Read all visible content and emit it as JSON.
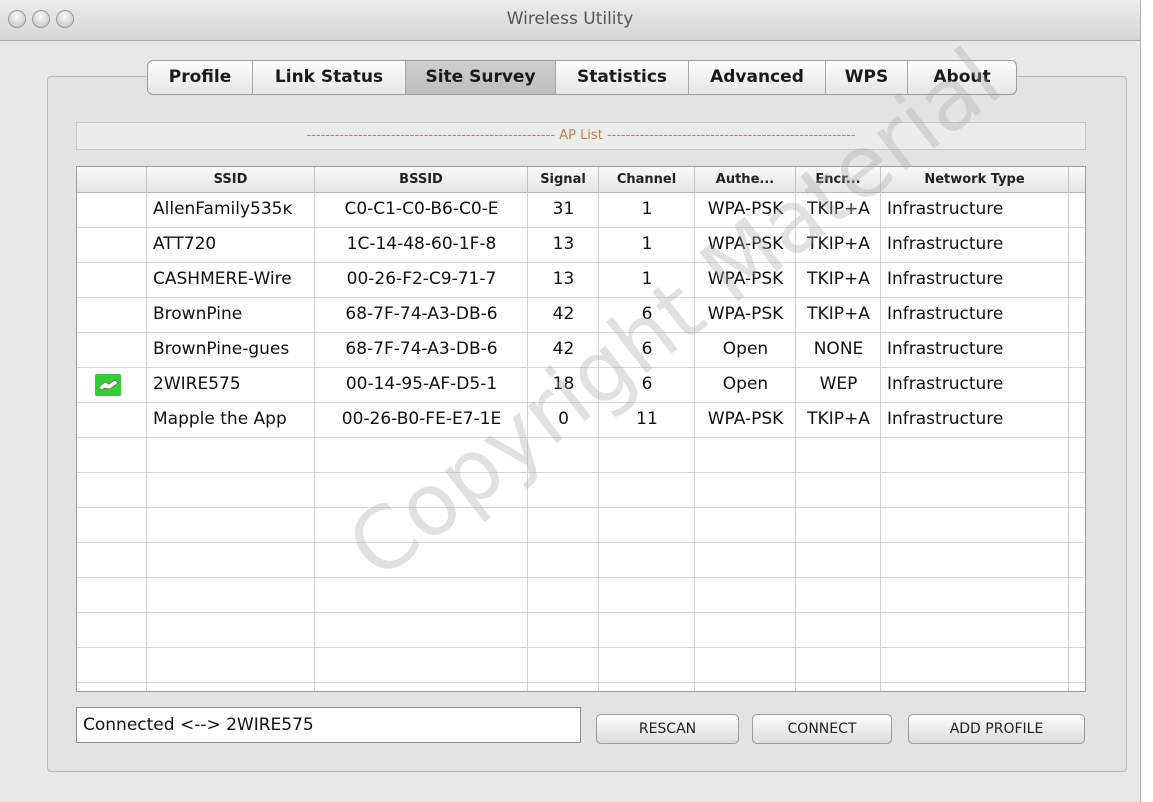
{
  "window": {
    "title": "Wireless Utility"
  },
  "tabs": [
    "Profile",
    "Link Status",
    "Site Survey",
    "Statistics",
    "Advanced",
    "WPS",
    "About"
  ],
  "active_tab": "Site Survey",
  "ap_list": {
    "label": "AP List"
  },
  "table": {
    "columns": [
      "SSID",
      "BSSID",
      "Signal",
      "Channel",
      "Authe...",
      "Encr...",
      "Network Type"
    ],
    "rows": [
      [
        "AllenFamily535ĸ",
        "C0-C1-C0-B6-C0-E",
        "31",
        "1",
        "WPA-PSK",
        "TKIP+A",
        "Infrastructure"
      ],
      [
        "ATT720",
        "1C-14-48-60-1F-8",
        "13",
        "1",
        "WPA-PSK",
        "TKIP+A",
        "Infrastructure"
      ],
      [
        "CASHMERE-Wire",
        "00-26-F2-C9-71-7",
        "13",
        "1",
        "WPA-PSK",
        "TKIP+A",
        "Infrastructure"
      ],
      [
        "BrownPine",
        "68-7F-74-A3-DB-6",
        "42",
        "6",
        "WPA-PSK",
        "TKIP+A",
        "Infrastructure"
      ],
      [
        "BrownPine-gues",
        "68-7F-74-A3-DB-6",
        "42",
        "6",
        "Open",
        "NONE",
        "Infrastructure"
      ],
      [
        "2WIRE575",
        "00-14-95-AF-D5-1",
        "18",
        "6",
        "Open",
        "WEP",
        "Infrastructure"
      ],
      [
        "Mapple the App",
        "00-26-B0-FE-E7-1E",
        "0",
        "11",
        "WPA-PSK",
        "TKIP+A",
        "Infrastructure"
      ]
    ],
    "connected_row_index": 5
  },
  "status": {
    "text": "Connected <--> 2WIRE575"
  },
  "buttons": {
    "rescan": "RESCAN",
    "connect": "CONNECT",
    "add_profile": "ADD PROFILE"
  },
  "watermark": "Copyright Material",
  "colors": {
    "connected_icon_bg": "#33cc33",
    "ap_list_label": "#c0834a"
  }
}
